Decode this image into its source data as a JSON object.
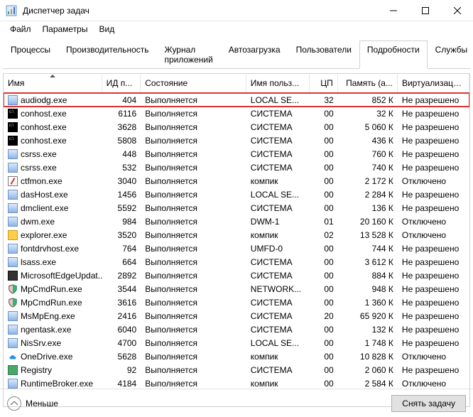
{
  "window": {
    "title": "Диспетчер задач"
  },
  "menu": {
    "file": "Файл",
    "options": "Параметры",
    "view": "Вид"
  },
  "tabs": {
    "items": [
      {
        "label": "Процессы"
      },
      {
        "label": "Производительность"
      },
      {
        "label": "Журнал приложений"
      },
      {
        "label": "Автозагрузка"
      },
      {
        "label": "Пользователи"
      },
      {
        "label": "Подробности"
      },
      {
        "label": "Службы"
      }
    ],
    "activeIndex": 5
  },
  "columns": {
    "name": "Имя",
    "pid": "ИД п...",
    "state": "Состояние",
    "user": "Имя польз...",
    "cpu": "ЦП",
    "memory": "Память (а...",
    "virt": "Виртуализаци..."
  },
  "rows": [
    {
      "icon": "default",
      "name": "audiodg.exe",
      "pid": "404",
      "state": "Выполняется",
      "user": "LOCAL SE...",
      "cpu": "32",
      "mem": "852 К",
      "virt": "Не разрешено",
      "highlight": true
    },
    {
      "icon": "console",
      "name": "conhost.exe",
      "pid": "6116",
      "state": "Выполняется",
      "user": "СИСТЕМА",
      "cpu": "00",
      "mem": "32 К",
      "virt": "Не разрешено"
    },
    {
      "icon": "console",
      "name": "conhost.exe",
      "pid": "3628",
      "state": "Выполняется",
      "user": "СИСТЕМА",
      "cpu": "00",
      "mem": "5 060 К",
      "virt": "Не разрешено"
    },
    {
      "icon": "console",
      "name": "conhost.exe",
      "pid": "5808",
      "state": "Выполняется",
      "user": "СИСТЕМА",
      "cpu": "00",
      "mem": "436 К",
      "virt": "Не разрешено"
    },
    {
      "icon": "default",
      "name": "csrss.exe",
      "pid": "448",
      "state": "Выполняется",
      "user": "СИСТЕМА",
      "cpu": "00",
      "mem": "760 К",
      "virt": "Не разрешено"
    },
    {
      "icon": "default",
      "name": "csrss.exe",
      "pid": "532",
      "state": "Выполняется",
      "user": "СИСТЕМА",
      "cpu": "00",
      "mem": "740 К",
      "virt": "Не разрешено"
    },
    {
      "icon": "pen",
      "name": "ctfmon.exe",
      "pid": "3040",
      "state": "Выполняется",
      "user": "компик",
      "cpu": "00",
      "mem": "2 172 К",
      "virt": "Отключено"
    },
    {
      "icon": "default",
      "name": "dasHost.exe",
      "pid": "1456",
      "state": "Выполняется",
      "user": "LOCAL SE...",
      "cpu": "00",
      "mem": "2 284 К",
      "virt": "Не разрешено"
    },
    {
      "icon": "default",
      "name": "dmclient.exe",
      "pid": "5592",
      "state": "Выполняется",
      "user": "СИСТЕМА",
      "cpu": "00",
      "mem": "136 К",
      "virt": "Не разрешено"
    },
    {
      "icon": "default",
      "name": "dwm.exe",
      "pid": "984",
      "state": "Выполняется",
      "user": "DWM-1",
      "cpu": "01",
      "mem": "20 160 К",
      "virt": "Отключено"
    },
    {
      "icon": "folder",
      "name": "explorer.exe",
      "pid": "3520",
      "state": "Выполняется",
      "user": "компик",
      "cpu": "02",
      "mem": "13 528 К",
      "virt": "Отключено"
    },
    {
      "icon": "default",
      "name": "fontdrvhost.exe",
      "pid": "764",
      "state": "Выполняется",
      "user": "UMFD-0",
      "cpu": "00",
      "mem": "744 К",
      "virt": "Не разрешено"
    },
    {
      "icon": "default",
      "name": "lsass.exe",
      "pid": "664",
      "state": "Выполняется",
      "user": "СИСТЕМА",
      "cpu": "00",
      "mem": "3 612 К",
      "virt": "Не разрешено"
    },
    {
      "icon": "dark",
      "name": "MicrosoftEdgeUpdat...",
      "pid": "2892",
      "state": "Выполняется",
      "user": "СИСТЕМА",
      "cpu": "00",
      "mem": "884 К",
      "virt": "Не разрешено"
    },
    {
      "icon": "shield",
      "name": "MpCmdRun.exe",
      "pid": "3544",
      "state": "Выполняется",
      "user": "NETWORK...",
      "cpu": "00",
      "mem": "948 К",
      "virt": "Не разрешено"
    },
    {
      "icon": "shield",
      "name": "MpCmdRun.exe",
      "pid": "3616",
      "state": "Выполняется",
      "user": "СИСТЕМА",
      "cpu": "00",
      "mem": "1 360 К",
      "virt": "Не разрешено"
    },
    {
      "icon": "default",
      "name": "MsMpEng.exe",
      "pid": "2416",
      "state": "Выполняется",
      "user": "СИСТЕМА",
      "cpu": "20",
      "mem": "65 920 К",
      "virt": "Не разрешено"
    },
    {
      "icon": "default",
      "name": "ngentask.exe",
      "pid": "6040",
      "state": "Выполняется",
      "user": "СИСТЕМА",
      "cpu": "00",
      "mem": "132 К",
      "virt": "Не разрешено"
    },
    {
      "icon": "default",
      "name": "NisSrv.exe",
      "pid": "4700",
      "state": "Выполняется",
      "user": "LOCAL SE...",
      "cpu": "00",
      "mem": "1 748 К",
      "virt": "Не разрешено"
    },
    {
      "icon": "cloud",
      "name": "OneDrive.exe",
      "pid": "5628",
      "state": "Выполняется",
      "user": "компик",
      "cpu": "00",
      "mem": "10 828 К",
      "virt": "Отключено"
    },
    {
      "icon": "reg",
      "name": "Registry",
      "pid": "92",
      "state": "Выполняется",
      "user": "СИСТЕМА",
      "cpu": "00",
      "mem": "2 060 К",
      "virt": "Не разрешено"
    },
    {
      "icon": "default",
      "name": "RuntimeBroker.exe",
      "pid": "4184",
      "state": "Выполняется",
      "user": "компик",
      "cpu": "00",
      "mem": "2 584 К",
      "virt": "Отключено"
    }
  ],
  "footer": {
    "fewer": "Меньше",
    "endTask": "Снять задачу"
  }
}
